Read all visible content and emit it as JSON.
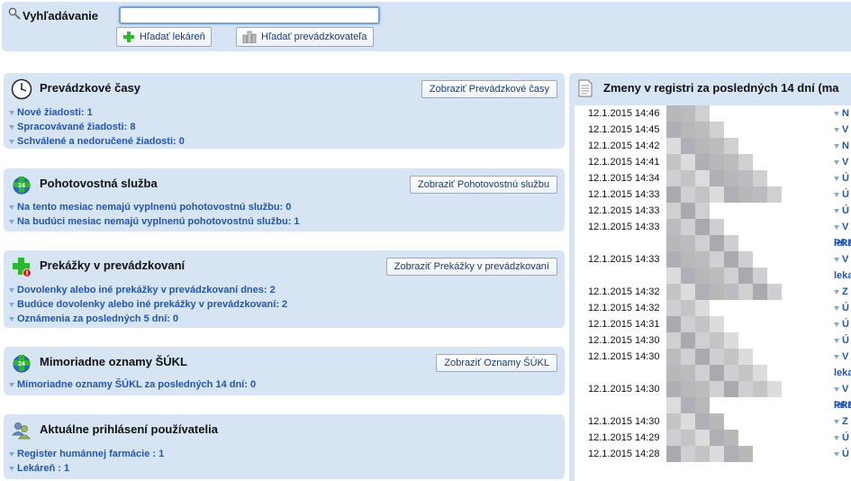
{
  "search": {
    "label": "Vyhľadávanie",
    "value": "",
    "placeholder": "",
    "btn_pharmacy": "Hľadať lekáreň",
    "btn_operator": "Hľadať prevádzkovateľa"
  },
  "panels": [
    {
      "title": "Prevádzkové časy",
      "icon": "clock-icon",
      "button": "Zobraziť Prevádzkové časy",
      "links": [
        "Nové žiadosti: 1",
        "Spracovávané žiadosti: 8",
        "Schválené a nedoručené žiadosti: 0"
      ]
    },
    {
      "title": "Pohotovostná služba",
      "icon": "pharmacy-globe-icon",
      "button": "Zobraziť Pohotovostnú službu",
      "links": [
        "Na tento mesiac nemajú vyplnenú pohotovostnú službu: 0",
        "Na budúci mesiac nemajú vyplnenú pohotovostnú službu: 1"
      ]
    },
    {
      "title": "Prekážky v prevádzkovaní",
      "icon": "pharmacy-cross-alert-icon",
      "button": "Zobraziť Prekážky v prevádzkovaní",
      "links": [
        "Dovolenky alebo iné prekážky v prevádzkovaní dnes: 2",
        "Budúce dovolenky alebo iné prekážky v prevádzkovaní: 2",
        "Oznámenia za posledných 5 dní: 0"
      ]
    },
    {
      "title": "Mimoriadne oznamy ŠÚKL",
      "icon": "pharmacy-globe-icon",
      "button": "Zobraziť Oznamy ŠÚKL",
      "links": [
        "Mimoriadne oznamy ŠÚKL za posledných 14 dní: 0"
      ]
    },
    {
      "title": "Aktuálne prihlásení používatelia",
      "icon": "users-icon",
      "button": "",
      "links": [
        "Register humánnej farmácie : 1",
        "Lekáreň : 1"
      ]
    }
  ],
  "changes": {
    "title": "Zmeny v registri za posledných 14 dní (ma",
    "rows": [
      {
        "time": "12.1.2015 14:46",
        "link": "N",
        "cont": ""
      },
      {
        "time": "12.1.2015 14:45",
        "link": "V",
        "cont": ""
      },
      {
        "time": "12.1.2015 14:42",
        "link": "N",
        "cont": ""
      },
      {
        "time": "12.1.2015 14:41",
        "link": "V",
        "cont": ""
      },
      {
        "time": "12.1.2015 14:34",
        "link": "Ú",
        "cont": ""
      },
      {
        "time": "12.1.2015 14:33",
        "link": "Ú",
        "cont": ""
      },
      {
        "time": "12.1.2015 14:33",
        "link": "Ú",
        "cont": ""
      },
      {
        "time": "12.1.2015 14:33",
        "link": "V",
        "cont": "PRE"
      },
      {
        "time": "",
        "link": "",
        "cont": "leka"
      },
      {
        "time": "12.1.2015 14:33",
        "link": "V",
        "cont": ""
      },
      {
        "time": "",
        "link": "",
        "cont": "leka"
      },
      {
        "time": "12.1.2015 14:32",
        "link": "Z",
        "cont": ""
      },
      {
        "time": "12.1.2015 14:32",
        "link": "Ú",
        "cont": ""
      },
      {
        "time": "12.1.2015 14:31",
        "link": "Ú",
        "cont": ""
      },
      {
        "time": "12.1.2015 14:30",
        "link": "Ú",
        "cont": ""
      },
      {
        "time": "12.1.2015 14:30",
        "link": "V",
        "cont": ""
      },
      {
        "time": "",
        "link": "",
        "cont": "leka"
      },
      {
        "time": "12.1.2015 14:30",
        "link": "V",
        "cont": "PRE"
      },
      {
        "time": "",
        "link": "",
        "cont": "leka"
      },
      {
        "time": "12.1.2015 14:30",
        "link": "Z",
        "cont": ""
      },
      {
        "time": "12.1.2015 14:29",
        "link": "Ú",
        "cont": ""
      },
      {
        "time": "12.1.2015 14:28",
        "link": "Ú",
        "cont": ""
      }
    ]
  }
}
